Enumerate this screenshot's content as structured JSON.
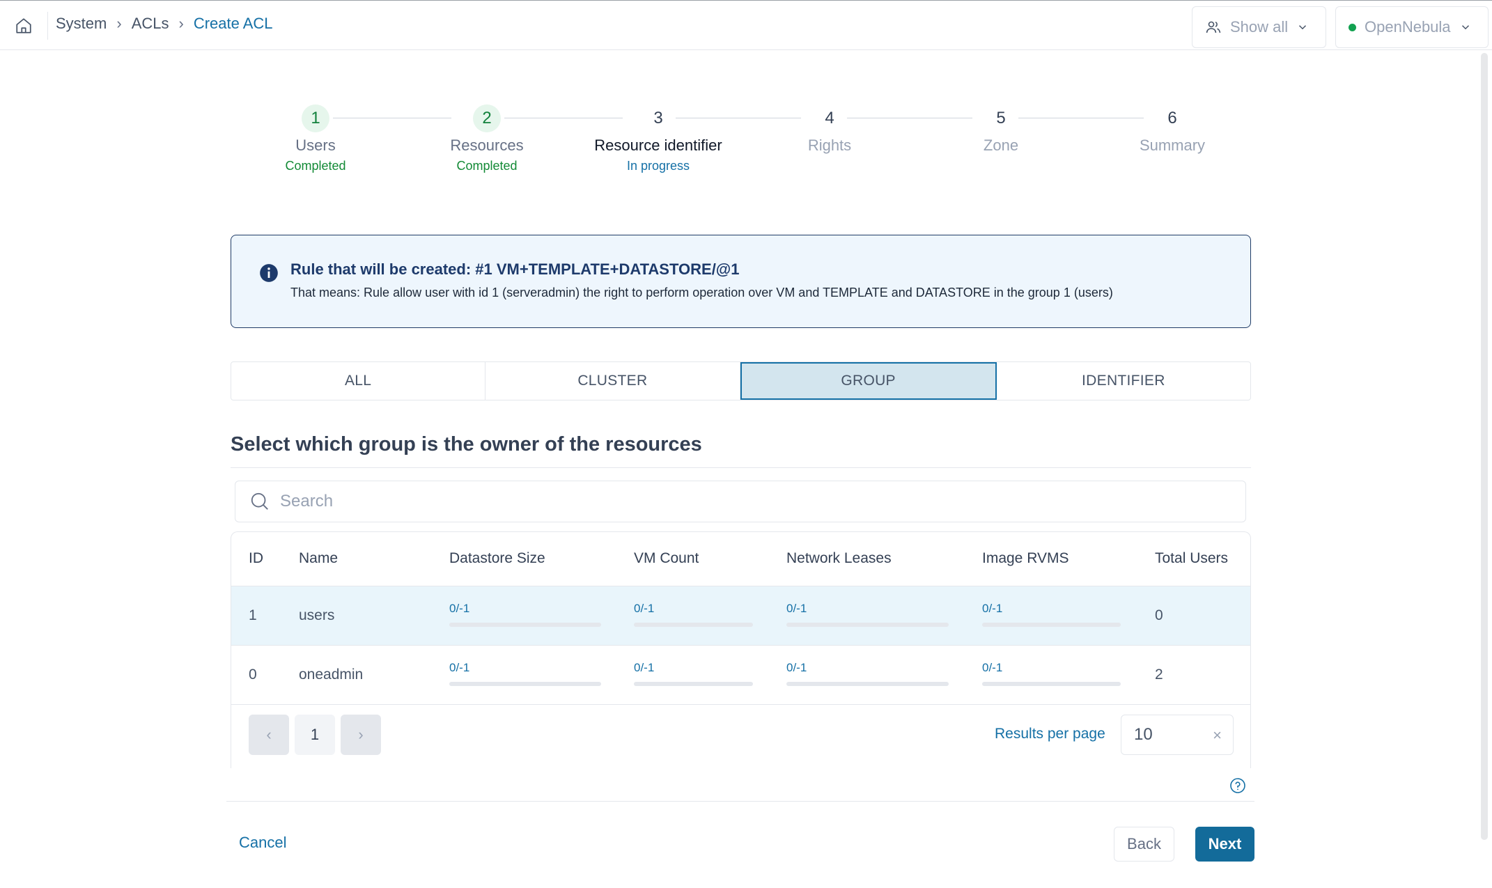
{
  "breadcrumb": {
    "items": [
      "System",
      "ACLs"
    ],
    "current": "Create ACL"
  },
  "header": {
    "users_filter": "Show all",
    "zone": "OpenNebula",
    "zone_status_color": "#12a150"
  },
  "stepper": [
    {
      "num": "1",
      "title": "Users",
      "status": "Completed",
      "state": "done"
    },
    {
      "num": "2",
      "title": "Resources",
      "status": "Completed",
      "state": "done"
    },
    {
      "num": "3",
      "title": "Resource identifier",
      "status": "In progress",
      "state": "active"
    },
    {
      "num": "4",
      "title": "Rights",
      "status": "",
      "state": "pending"
    },
    {
      "num": "5",
      "title": "Zone",
      "status": "",
      "state": "pending"
    },
    {
      "num": "6",
      "title": "Summary",
      "status": "",
      "state": "pending"
    }
  ],
  "alert": {
    "icon": "info-icon",
    "title": "Rule that will be created: #1 VM+TEMPLATE+DATASTORE/@1",
    "body": "That means: Rule allow user with id 1 (serveradmin) the right to perform operation over VM and TEMPLATE and DATASTORE in the group 1 (users)"
  },
  "tabs": [
    {
      "label": "ALL",
      "selected": false
    },
    {
      "label": "CLUSTER",
      "selected": false
    },
    {
      "label": "GROUP",
      "selected": true
    },
    {
      "label": "IDENTIFIER",
      "selected": false
    }
  ],
  "section_title": "Select which group is the owner of the resources",
  "search": {
    "placeholder": "Search",
    "value": ""
  },
  "table": {
    "columns": [
      "ID",
      "Name",
      "Datastore Size",
      "VM Count",
      "Network Leases",
      "Image RVMS",
      "Total Users"
    ],
    "rows": [
      {
        "id": "1",
        "name": "users",
        "datastore": "0/-1",
        "vm": "0/-1",
        "network": "0/-1",
        "image": "0/-1",
        "users": "0",
        "selected": true
      },
      {
        "id": "0",
        "name": "oneadmin",
        "datastore": "0/-1",
        "vm": "0/-1",
        "network": "0/-1",
        "image": "0/-1",
        "users": "2",
        "selected": false
      }
    ]
  },
  "pagination": {
    "prev": "‹",
    "page": "1",
    "next": "›",
    "results_per_page_label": "Results per page",
    "results_per_page": "10",
    "clear": "×"
  },
  "footer": {
    "cancel": "Cancel",
    "back": "Back",
    "next": "Next"
  }
}
